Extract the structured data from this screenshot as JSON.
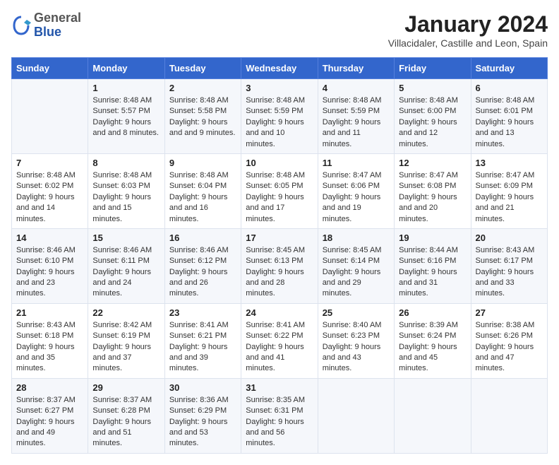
{
  "header": {
    "logo_general": "General",
    "logo_blue": "Blue",
    "month_title": "January 2024",
    "location": "Villacidaler, Castille and Leon, Spain"
  },
  "days_of_week": [
    "Sunday",
    "Monday",
    "Tuesday",
    "Wednesday",
    "Thursday",
    "Friday",
    "Saturday"
  ],
  "weeks": [
    [
      {
        "day": "",
        "sunrise": "",
        "sunset": "",
        "daylight": ""
      },
      {
        "day": "1",
        "sunrise": "Sunrise: 8:48 AM",
        "sunset": "Sunset: 5:57 PM",
        "daylight": "Daylight: 9 hours and 8 minutes."
      },
      {
        "day": "2",
        "sunrise": "Sunrise: 8:48 AM",
        "sunset": "Sunset: 5:58 PM",
        "daylight": "Daylight: 9 hours and 9 minutes."
      },
      {
        "day": "3",
        "sunrise": "Sunrise: 8:48 AM",
        "sunset": "Sunset: 5:59 PM",
        "daylight": "Daylight: 9 hours and 10 minutes."
      },
      {
        "day": "4",
        "sunrise": "Sunrise: 8:48 AM",
        "sunset": "Sunset: 5:59 PM",
        "daylight": "Daylight: 9 hours and 11 minutes."
      },
      {
        "day": "5",
        "sunrise": "Sunrise: 8:48 AM",
        "sunset": "Sunset: 6:00 PM",
        "daylight": "Daylight: 9 hours and 12 minutes."
      },
      {
        "day": "6",
        "sunrise": "Sunrise: 8:48 AM",
        "sunset": "Sunset: 6:01 PM",
        "daylight": "Daylight: 9 hours and 13 minutes."
      }
    ],
    [
      {
        "day": "7",
        "sunrise": "Sunrise: 8:48 AM",
        "sunset": "Sunset: 6:02 PM",
        "daylight": "Daylight: 9 hours and 14 minutes."
      },
      {
        "day": "8",
        "sunrise": "Sunrise: 8:48 AM",
        "sunset": "Sunset: 6:03 PM",
        "daylight": "Daylight: 9 hours and 15 minutes."
      },
      {
        "day": "9",
        "sunrise": "Sunrise: 8:48 AM",
        "sunset": "Sunset: 6:04 PM",
        "daylight": "Daylight: 9 hours and 16 minutes."
      },
      {
        "day": "10",
        "sunrise": "Sunrise: 8:48 AM",
        "sunset": "Sunset: 6:05 PM",
        "daylight": "Daylight: 9 hours and 17 minutes."
      },
      {
        "day": "11",
        "sunrise": "Sunrise: 8:47 AM",
        "sunset": "Sunset: 6:06 PM",
        "daylight": "Daylight: 9 hours and 19 minutes."
      },
      {
        "day": "12",
        "sunrise": "Sunrise: 8:47 AM",
        "sunset": "Sunset: 6:08 PM",
        "daylight": "Daylight: 9 hours and 20 minutes."
      },
      {
        "day": "13",
        "sunrise": "Sunrise: 8:47 AM",
        "sunset": "Sunset: 6:09 PM",
        "daylight": "Daylight: 9 hours and 21 minutes."
      }
    ],
    [
      {
        "day": "14",
        "sunrise": "Sunrise: 8:46 AM",
        "sunset": "Sunset: 6:10 PM",
        "daylight": "Daylight: 9 hours and 23 minutes."
      },
      {
        "day": "15",
        "sunrise": "Sunrise: 8:46 AM",
        "sunset": "Sunset: 6:11 PM",
        "daylight": "Daylight: 9 hours and 24 minutes."
      },
      {
        "day": "16",
        "sunrise": "Sunrise: 8:46 AM",
        "sunset": "Sunset: 6:12 PM",
        "daylight": "Daylight: 9 hours and 26 minutes."
      },
      {
        "day": "17",
        "sunrise": "Sunrise: 8:45 AM",
        "sunset": "Sunset: 6:13 PM",
        "daylight": "Daylight: 9 hours and 28 minutes."
      },
      {
        "day": "18",
        "sunrise": "Sunrise: 8:45 AM",
        "sunset": "Sunset: 6:14 PM",
        "daylight": "Daylight: 9 hours and 29 minutes."
      },
      {
        "day": "19",
        "sunrise": "Sunrise: 8:44 AM",
        "sunset": "Sunset: 6:16 PM",
        "daylight": "Daylight: 9 hours and 31 minutes."
      },
      {
        "day": "20",
        "sunrise": "Sunrise: 8:43 AM",
        "sunset": "Sunset: 6:17 PM",
        "daylight": "Daylight: 9 hours and 33 minutes."
      }
    ],
    [
      {
        "day": "21",
        "sunrise": "Sunrise: 8:43 AM",
        "sunset": "Sunset: 6:18 PM",
        "daylight": "Daylight: 9 hours and 35 minutes."
      },
      {
        "day": "22",
        "sunrise": "Sunrise: 8:42 AM",
        "sunset": "Sunset: 6:19 PM",
        "daylight": "Daylight: 9 hours and 37 minutes."
      },
      {
        "day": "23",
        "sunrise": "Sunrise: 8:41 AM",
        "sunset": "Sunset: 6:21 PM",
        "daylight": "Daylight: 9 hours and 39 minutes."
      },
      {
        "day": "24",
        "sunrise": "Sunrise: 8:41 AM",
        "sunset": "Sunset: 6:22 PM",
        "daylight": "Daylight: 9 hours and 41 minutes."
      },
      {
        "day": "25",
        "sunrise": "Sunrise: 8:40 AM",
        "sunset": "Sunset: 6:23 PM",
        "daylight": "Daylight: 9 hours and 43 minutes."
      },
      {
        "day": "26",
        "sunrise": "Sunrise: 8:39 AM",
        "sunset": "Sunset: 6:24 PM",
        "daylight": "Daylight: 9 hours and 45 minutes."
      },
      {
        "day": "27",
        "sunrise": "Sunrise: 8:38 AM",
        "sunset": "Sunset: 6:26 PM",
        "daylight": "Daylight: 9 hours and 47 minutes."
      }
    ],
    [
      {
        "day": "28",
        "sunrise": "Sunrise: 8:37 AM",
        "sunset": "Sunset: 6:27 PM",
        "daylight": "Daylight: 9 hours and 49 minutes."
      },
      {
        "day": "29",
        "sunrise": "Sunrise: 8:37 AM",
        "sunset": "Sunset: 6:28 PM",
        "daylight": "Daylight: 9 hours and 51 minutes."
      },
      {
        "day": "30",
        "sunrise": "Sunrise: 8:36 AM",
        "sunset": "Sunset: 6:29 PM",
        "daylight": "Daylight: 9 hours and 53 minutes."
      },
      {
        "day": "31",
        "sunrise": "Sunrise: 8:35 AM",
        "sunset": "Sunset: 6:31 PM",
        "daylight": "Daylight: 9 hours and 56 minutes."
      },
      {
        "day": "",
        "sunrise": "",
        "sunset": "",
        "daylight": ""
      },
      {
        "day": "",
        "sunrise": "",
        "sunset": "",
        "daylight": ""
      },
      {
        "day": "",
        "sunrise": "",
        "sunset": "",
        "daylight": ""
      }
    ]
  ]
}
